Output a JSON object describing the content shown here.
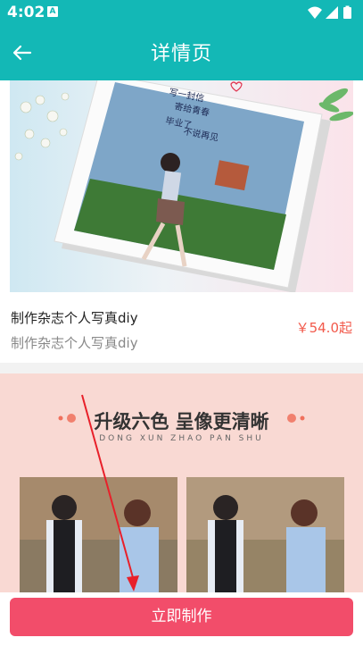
{
  "status": {
    "time": "4:02",
    "notification_letter": "A"
  },
  "appbar": {
    "title": "详情页",
    "back_icon": "arrow-left-icon"
  },
  "product": {
    "name": "制作杂志个人写真diy",
    "subtitle": "制作杂志个人写真diy",
    "price": "￥54.0起"
  },
  "photo_caption": {
    "line1": "写一封信",
    "line2": "寄给青春",
    "line3": "毕业了",
    "line4": "不说再见"
  },
  "banner": {
    "headline": "升级六色 呈像更清晰",
    "pinyin": "DONG XUN ZHAO PAN SHU"
  },
  "bottom": {
    "button_label": "立即制作"
  },
  "colors": {
    "primary": "#13b8b6",
    "accent": "#f24d6a",
    "price": "#f2594b"
  }
}
